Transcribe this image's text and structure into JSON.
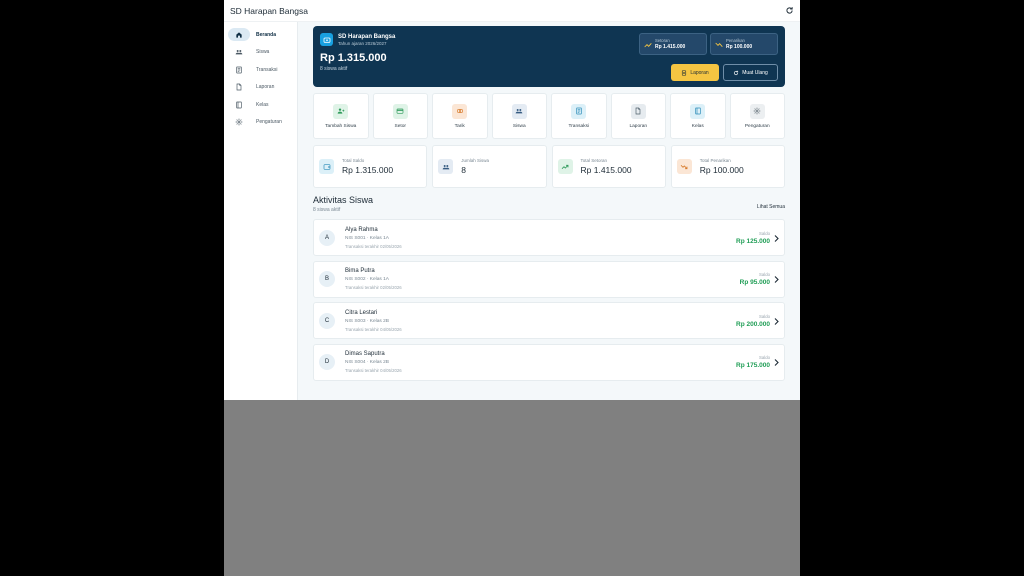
{
  "app": {
    "title": "SD Harapan Bangsa"
  },
  "sidebar": {
    "items": [
      {
        "label": "Beranda",
        "icon": "home-icon",
        "active": true
      },
      {
        "label": "Siswa",
        "icon": "users-icon",
        "active": false
      },
      {
        "label": "Transaksi",
        "icon": "receipt-icon",
        "active": false
      },
      {
        "label": "Laporan",
        "icon": "document-icon",
        "active": false
      },
      {
        "label": "Kelas",
        "icon": "book-icon",
        "active": false
      },
      {
        "label": "Pengaturan",
        "icon": "gear-icon",
        "active": false
      }
    ]
  },
  "hero": {
    "school_name": "SD Harapan Bangsa",
    "school_year": "Tahun ajaran 2026/2027",
    "total": "Rp 1.315.000",
    "active_students": "8 siswa aktif",
    "setoran": {
      "label": "Setoran",
      "value": "Rp 1.415.000"
    },
    "penarikan": {
      "label": "Penarikan",
      "value": "Rp 100.000"
    },
    "laporan_label": "Laporan",
    "muat_ulang_label": "Muat Ulang"
  },
  "quick_actions": [
    {
      "label": "Tambah Siswa",
      "icon": "user-plus-icon",
      "color": "#dff3e7",
      "fg": "#2e9a5a"
    },
    {
      "label": "Setor",
      "icon": "card-icon",
      "color": "#dff3e7",
      "fg": "#2e9a5a"
    },
    {
      "label": "Tarik",
      "icon": "coins-icon",
      "color": "#fbe6d5",
      "fg": "#d77a2b"
    },
    {
      "label": "Siswa",
      "icon": "users-icon",
      "color": "#e4ebf3",
      "fg": "#355a80"
    },
    {
      "label": "Transaksi",
      "icon": "receipt-icon",
      "color": "#dcf0f8",
      "fg": "#2a8bb8"
    },
    {
      "label": "Laporan",
      "icon": "document-icon",
      "color": "#e6ebef",
      "fg": "#4d5d6a"
    },
    {
      "label": "Kelas",
      "icon": "book-icon",
      "color": "#dcf0f8",
      "fg": "#2a8bb8"
    },
    {
      "label": "Pengaturan",
      "icon": "gear-icon",
      "color": "#eceff1",
      "fg": "#5a6770"
    }
  ],
  "stats": [
    {
      "label": "Total Saldo",
      "value": "Rp 1.315.000",
      "icon": "wallet-icon",
      "color": "#dcf0f8",
      "fg": "#2a8bb8"
    },
    {
      "label": "Jumlah Siswa",
      "value": "8",
      "icon": "users-icon",
      "color": "#e4ebf3",
      "fg": "#355a80"
    },
    {
      "label": "Total Setoran",
      "value": "Rp 1.415.000",
      "icon": "trend-up-icon",
      "color": "#dff3e7",
      "fg": "#2e9a5a"
    },
    {
      "label": "Total Penarikan",
      "value": "Rp 100.000",
      "icon": "trend-down-icon",
      "color": "#fbe6d5",
      "fg": "#d77a2b"
    }
  ],
  "activity": {
    "title": "Aktivitas Siswa",
    "subtitle": "8 siswa aktif",
    "see_all": "Lihat Semua",
    "saldo_label": "Saldo",
    "students": [
      {
        "initial": "A",
        "name": "Alya Rahma",
        "nis": "NIS S001 · Kelas 1A",
        "last": "Transaksi terakhir 02/05/2026",
        "balance": "Rp 125.000"
      },
      {
        "initial": "B",
        "name": "Bima Putra",
        "nis": "NIS S002 · Kelas 1A",
        "last": "Transaksi terakhir 02/05/2026",
        "balance": "Rp 95.000"
      },
      {
        "initial": "C",
        "name": "Citra Lestari",
        "nis": "NIS S003 · Kelas 2B",
        "last": "Transaksi terakhir 04/05/2026",
        "balance": "Rp 200.000"
      },
      {
        "initial": "D",
        "name": "Dimas Saputra",
        "nis": "NIS S004 · Kelas 2B",
        "last": "Transaksi terakhir 04/05/2026",
        "balance": "Rp 175.000"
      }
    ]
  }
}
